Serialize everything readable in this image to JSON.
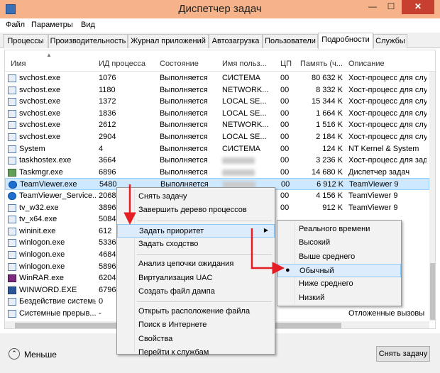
{
  "window": {
    "title": "Диспетчер задач",
    "minimize": "—",
    "maximize": "☐",
    "close": "✕"
  },
  "menu": [
    "Файл",
    "Параметры",
    "Вид"
  ],
  "tabs": [
    "Процессы",
    "Производительность",
    "Журнал приложений",
    "Автозагрузка",
    "Пользователи",
    "Подробности",
    "Службы"
  ],
  "active_tab": "Подробности",
  "columns": [
    "Имя",
    "ИД процесса",
    "Состояние",
    "Имя польз...",
    "ЦП",
    "Память (ч...",
    "Описание"
  ],
  "rows": [
    {
      "icon": "svc-icon",
      "name": "svchost.exe",
      "pid": "1076",
      "state": "Выполняется",
      "user": "СИСТЕМА",
      "cpu": "00",
      "mem": "80 632 K",
      "desc": "Хост-процесс для служб"
    },
    {
      "icon": "svc-icon",
      "name": "svchost.exe",
      "pid": "1180",
      "state": "Выполняется",
      "user": "NETWORK...",
      "cpu": "00",
      "mem": "8 332 K",
      "desc": "Хост-процесс для служб"
    },
    {
      "icon": "svc-icon",
      "name": "svchost.exe",
      "pid": "1372",
      "state": "Выполняется",
      "user": "LOCAL SE...",
      "cpu": "00",
      "mem": "15 344 K",
      "desc": "Хост-процесс для служб"
    },
    {
      "icon": "svc-icon",
      "name": "svchost.exe",
      "pid": "1836",
      "state": "Выполняется",
      "user": "LOCAL SE...",
      "cpu": "00",
      "mem": "1 664 K",
      "desc": "Хост-процесс для служб"
    },
    {
      "icon": "svc-icon",
      "name": "svchost.exe",
      "pid": "2612",
      "state": "Выполняется",
      "user": "NETWORK...",
      "cpu": "00",
      "mem": "1 516 K",
      "desc": "Хост-процесс для служб"
    },
    {
      "icon": "svc-icon",
      "name": "svchost.exe",
      "pid": "2904",
      "state": "Выполняется",
      "user": "LOCAL SE...",
      "cpu": "00",
      "mem": "2 184 K",
      "desc": "Хост-процесс для служб"
    },
    {
      "icon": "svc-icon",
      "name": "System",
      "pid": "4",
      "state": "Выполняется",
      "user": "СИСТЕМА",
      "cpu": "00",
      "mem": "124 K",
      "desc": "NT Kernel & System"
    },
    {
      "icon": "svc-icon",
      "name": "taskhostex.exe",
      "pid": "3664",
      "state": "Выполняется",
      "user": "",
      "cpu": "00",
      "mem": "3 236 K",
      "desc": "Хост-процесс для задач"
    },
    {
      "icon": "taskmgr-icon",
      "name": "Taskmgr.exe",
      "pid": "6896",
      "state": "Выполняется",
      "user": "",
      "cpu": "00",
      "mem": "14 680 K",
      "desc": "Диспетчер задач"
    },
    {
      "icon": "teamviewer-icon",
      "name": "TeamViewer.exe",
      "pid": "5480",
      "state": "Выполняется",
      "user": "",
      "cpu": "00",
      "mem": "6 912 K",
      "desc": "TeamViewer 9",
      "selected": true
    },
    {
      "icon": "teamviewer-icon",
      "name": "TeamViewer_Service...",
      "pid": "2068",
      "state": "",
      "user": "",
      "cpu": "00",
      "mem": "4 156 K",
      "desc": "TeamViewer 9"
    },
    {
      "icon": "svc-icon",
      "name": "tv_w32.exe",
      "pid": "3896",
      "state": "",
      "user": "",
      "cpu": "00",
      "mem": "912 K",
      "desc": "TeamViewer 9"
    },
    {
      "icon": "svc-icon",
      "name": "tv_x64.exe",
      "pid": "5084",
      "state": "",
      "user": "",
      "cpu": "",
      "mem": "",
      "desc": ""
    },
    {
      "icon": "svc-icon",
      "name": "wininit.exe",
      "pid": "612",
      "state": "",
      "user": "",
      "cpu": "",
      "mem": "",
      "desc": ""
    },
    {
      "icon": "svc-icon",
      "name": "winlogon.exe",
      "pid": "5336",
      "state": "",
      "user": "",
      "cpu": "",
      "mem": "",
      "desc": ""
    },
    {
      "icon": "svc-icon",
      "name": "winlogon.exe",
      "pid": "4684",
      "state": "",
      "user": "",
      "cpu": "",
      "mem": "",
      "desc": ""
    },
    {
      "icon": "svc-icon",
      "name": "winlogon.exe",
      "pid": "5896",
      "state": "",
      "user": "",
      "cpu": "",
      "mem": "",
      "desc": ""
    },
    {
      "icon": "winrar-icon",
      "name": "WinRAR.exe",
      "pid": "6204",
      "state": "",
      "user": "",
      "cpu": "",
      "mem": "",
      "desc": ""
    },
    {
      "icon": "word-icon",
      "name": "WINWORD.EXE",
      "pid": "6796",
      "state": "",
      "user": "",
      "cpu": "",
      "mem": "",
      "desc": "Word"
    },
    {
      "icon": "svc-icon",
      "name": "Бездействие системы",
      "pid": "0",
      "state": "",
      "user": "",
      "cpu": "",
      "mem": "",
      "desc": "ссов..."
    },
    {
      "icon": "svc-icon",
      "name": "Системные прерыв...",
      "pid": "-",
      "state": "",
      "user": "",
      "cpu": "",
      "mem": "",
      "desc": "Отложенные вызовы пр"
    }
  ],
  "context_menu": [
    {
      "label": "Снять задачу"
    },
    {
      "label": "Завершить дерево процессов"
    },
    {
      "sep": true
    },
    {
      "label": "Задать приоритет",
      "submenu": true,
      "highlighted": true
    },
    {
      "label": "Задать сходство"
    },
    {
      "sep": true
    },
    {
      "label": "Анализ цепочки ожидания"
    },
    {
      "label": "Виртуализация UAC"
    },
    {
      "label": "Создать файл дампа"
    },
    {
      "sep": true
    },
    {
      "label": "Открыть расположение файла"
    },
    {
      "label": "Поиск в Интернете"
    },
    {
      "label": "Свойства"
    },
    {
      "label": "Перейти к службам"
    }
  ],
  "priority_submenu": [
    {
      "label": "Реального времени"
    },
    {
      "label": "Высокий"
    },
    {
      "label": "Выше среднего"
    },
    {
      "label": "Обычный",
      "checked": true
    },
    {
      "label": "Ниже среднего"
    },
    {
      "label": "Низкий"
    }
  ],
  "footer": {
    "less_label": "Меньше",
    "end_task": "Снять задачу"
  },
  "colors": {
    "titlebar": "#f6b38a",
    "arrow": "#e51d24",
    "selection": "#cde8ff"
  }
}
